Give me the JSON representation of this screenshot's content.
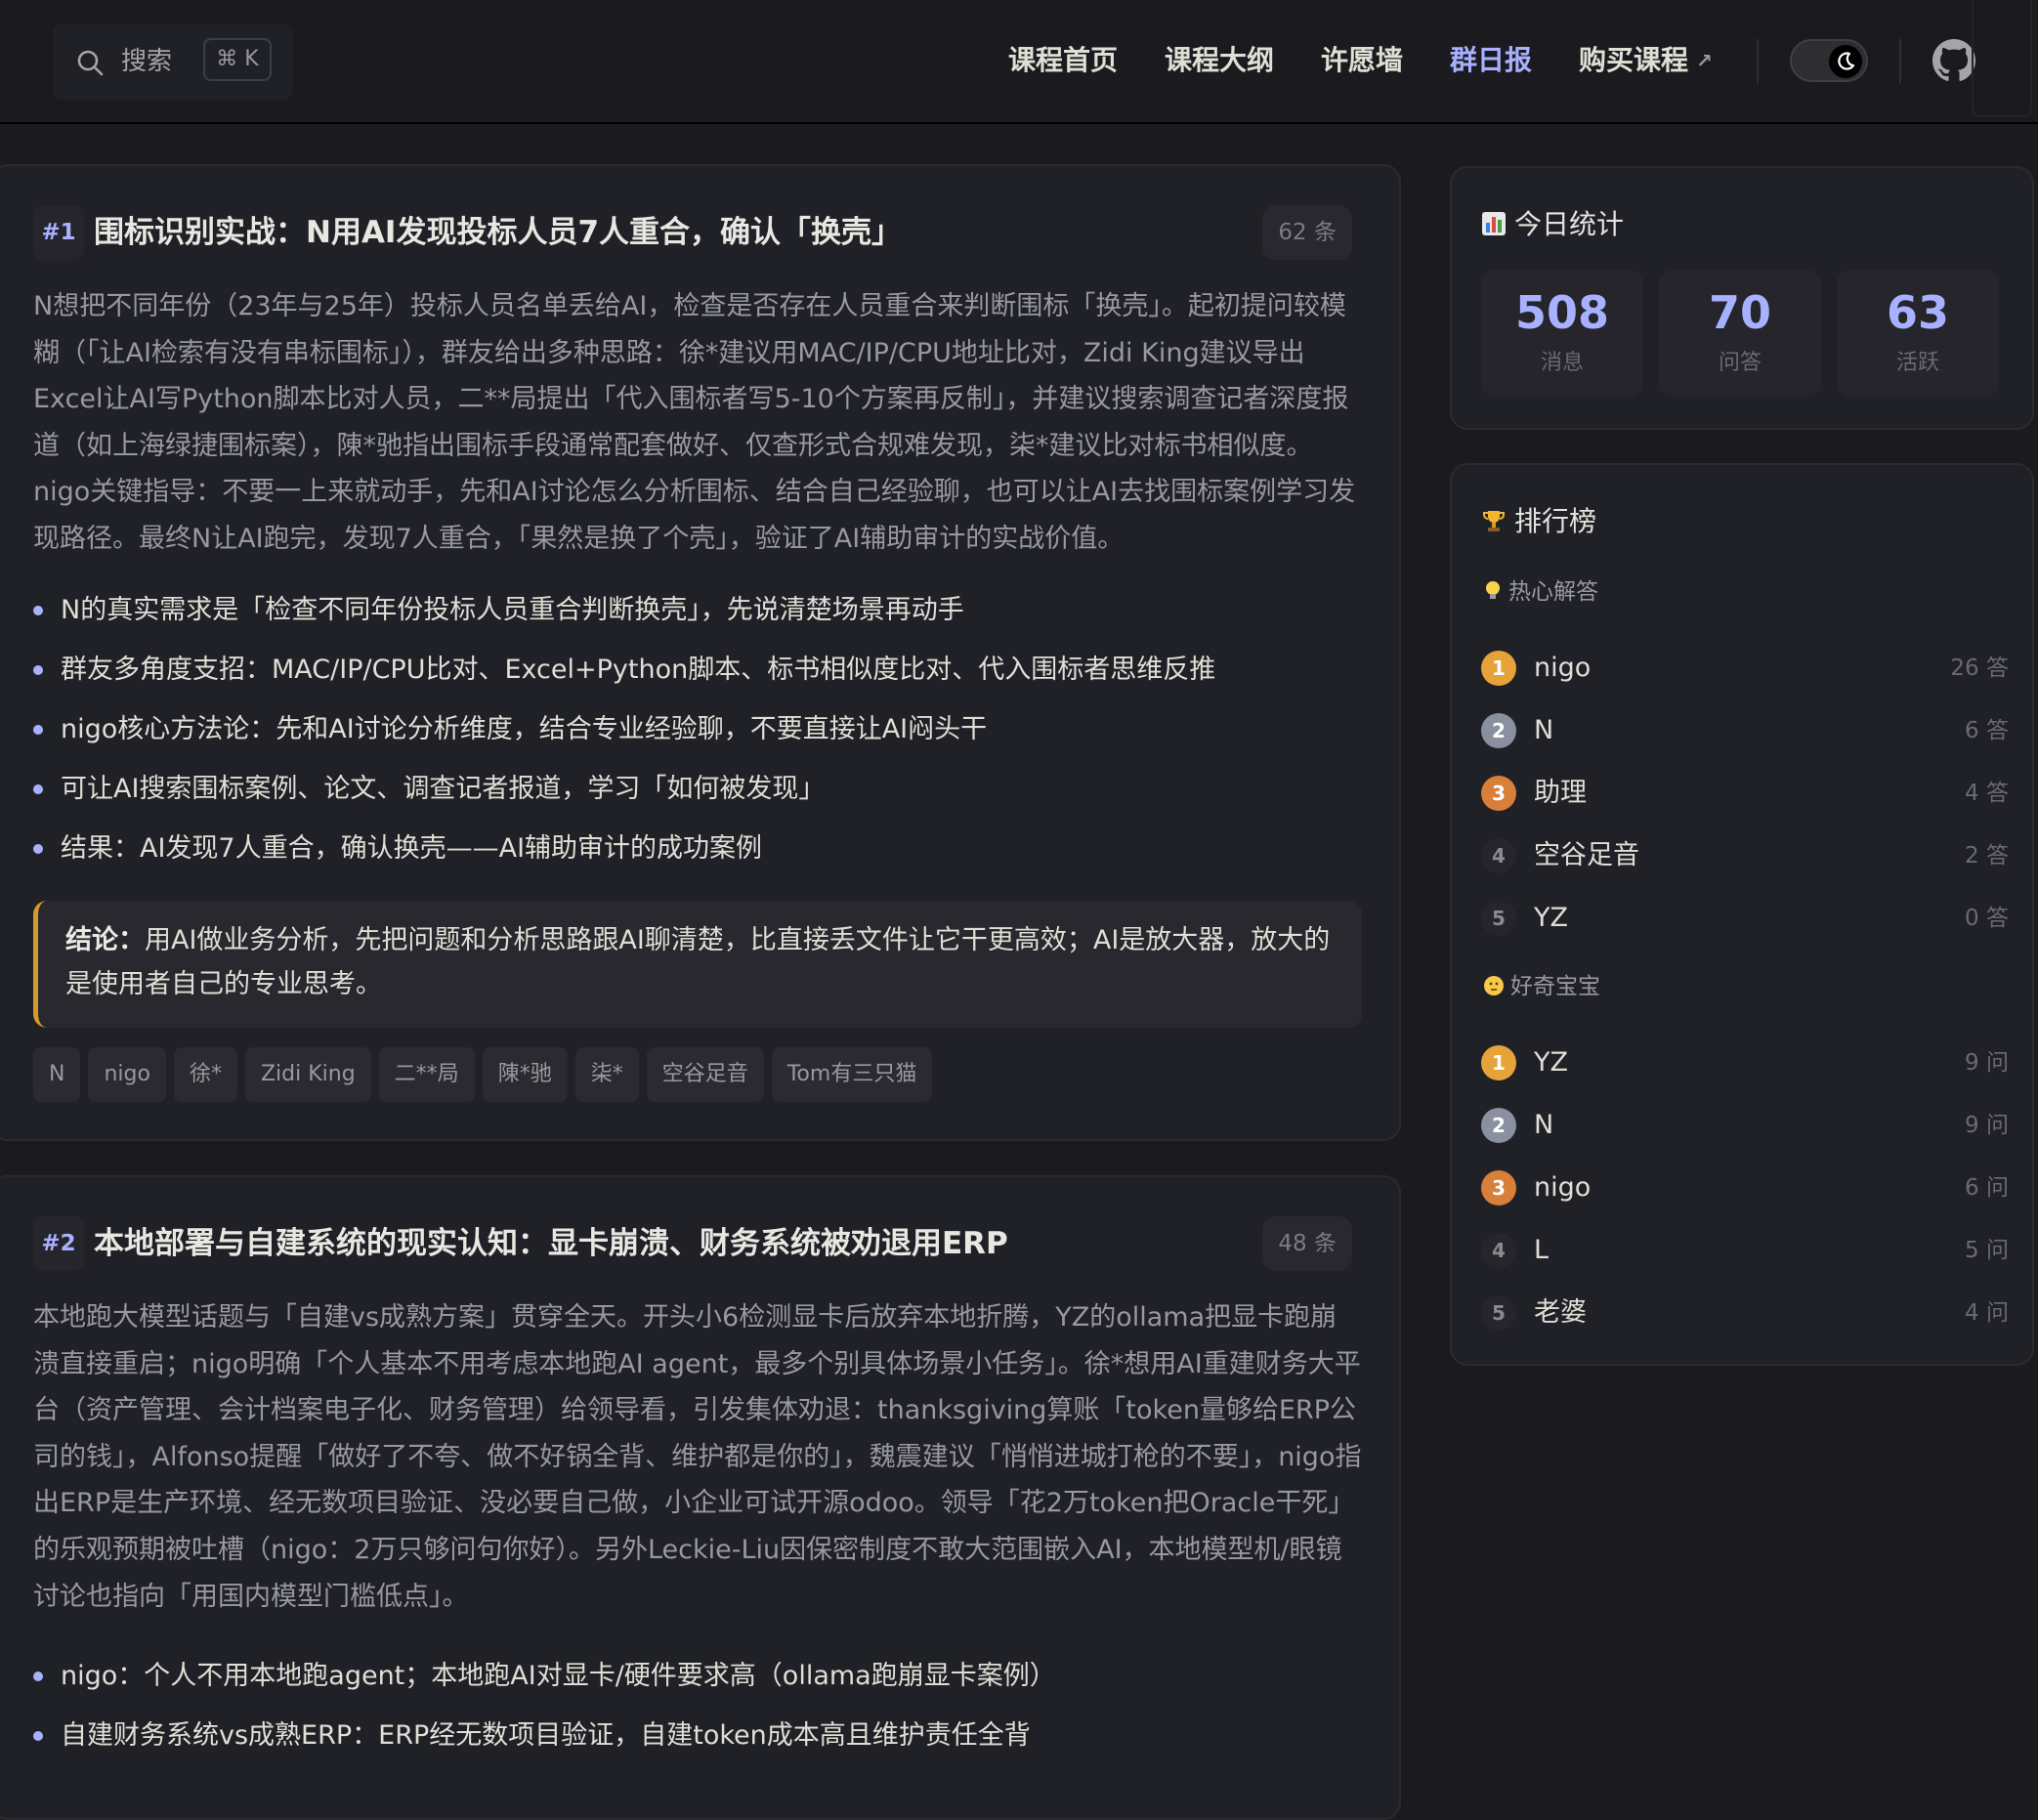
{
  "nav": {
    "search_label": "搜索",
    "search_shortcut": "⌘ K",
    "items": [
      {
        "label": "课程首页"
      },
      {
        "label": "课程大纲"
      },
      {
        "label": "许愿墙"
      },
      {
        "label": "群日报"
      },
      {
        "label": "购买课程"
      }
    ],
    "active_index": 3,
    "external_arrow": "↗"
  },
  "reports": [
    {
      "rank": "#1",
      "title": "围标识别实战：N用AI发现投标人员7人重合，确认「换壳」",
      "count": "62 条",
      "summary": "N想把不同年份（23年与25年）投标人员名单丢给AI，检查是否存在人员重合来判断围标「换壳」。起初提问较模糊（「让AI检索有没有串标围标」），群友给出多种思路：徐*建议用MAC/IP/CPU地址比对，Zidi King建议导出Excel让AI写Python脚本比对人员，二**局提出「代入围标者写5-10个方案再反制」，并建议搜索调查记者深度报道（如上海绿捷围标案），陳*驰指出围标手段通常配套做好、仅查形式合规难发现，柒*建议比对标书相似度。nigo关键指导：不要一上来就动手，先和AI讨论怎么分析围标、结合自己经验聊，也可以让AI去找围标案例学习发现路径。最终N让AI跑完，发现7人重合，「果然是换了个壳」，验证了AI辅助审计的实战价值。",
      "bullets": [
        "N的真实需求是「检查不同年份投标人员重合判断换壳」，先说清楚场景再动手",
        "群友多角度支招：MAC/IP/CPU比对、Excel+Python脚本、标书相似度比对、代入围标者思维反推",
        "nigo核心方法论：先和AI讨论分析维度，结合专业经验聊，不要直接让AI闷头干",
        "可让AI搜索围标案例、论文、调查记者报道，学习「如何被发现」",
        "结果：AI发现7人重合，确认换壳——AI辅助审计的成功案例"
      ],
      "conclusion_label": "结论：",
      "conclusion_text": "用AI做业务分析，先把问题和分析思路跟AI聊清楚，比直接丢文件让它干更高效；AI是放大器，放大的是使用者自己的专业思考。",
      "tags": [
        "N",
        "nigo",
        "徐*",
        "Zidi King",
        "二**局",
        "陳*驰",
        "柒*",
        "空谷足音",
        "Tom有三只猫"
      ]
    },
    {
      "rank": "#2",
      "title": "本地部署与自建系统的现实认知：显卡崩溃、财务系统被劝退用ERP",
      "count": "48 条",
      "summary": "本地跑大模型话题与「自建vs成熟方案」贯穿全天。开头小6检测显卡后放弃本地折腾，YZ的ollama把显卡跑崩溃直接重启；nigo明确「个人基本不用考虑本地跑AI agent，最多个别具体场景小任务」。徐*想用AI重建财务大平台（资产管理、会计档案电子化、财务管理）给领导看，引发集体劝退：thanksgiving算账「token量够给ERP公司的钱」，Alfonso提醒「做好了不夸、做不好锅全背、维护都是你的」，魏震建议「悄悄进城打枪的不要」，nigo指出ERP是生产环境、经无数项目验证、没必要自己做，小企业可试开源odoo。领导「花2万token把Oracle干死」的乐观预期被吐槽（nigo：2万只够问句你好）。另外Leckie-Liu因保密制度不敢大范围嵌入AI，本地模型机/眼镜讨论也指向「用国内模型门槛低点」。",
      "bullets": [
        "nigo：个人不用本地跑agent；本地跑AI对显卡/硬件要求高（ollama跑崩显卡案例）",
        "自建财务系统vs成熟ERP：ERP经无数项目验证，自建token成本高且维护责任全背"
      ]
    }
  ],
  "stats": {
    "title": "今日统计",
    "icon": "bar-chart-icon",
    "items": [
      {
        "value": "508",
        "label": "消息"
      },
      {
        "value": "70",
        "label": "问答"
      },
      {
        "value": "63",
        "label": "活跃"
      }
    ]
  },
  "leaderboard": {
    "title": "排行榜",
    "icon": "trophy-icon",
    "groups": [
      {
        "title": "热心解答",
        "icon": "lightbulb-icon",
        "rows": [
          {
            "rank": "1",
            "name": "nigo",
            "count": "26 答"
          },
          {
            "rank": "2",
            "name": "N",
            "count": "6 答"
          },
          {
            "rank": "3",
            "name": "助理",
            "count": "4 答"
          },
          {
            "rank": "4",
            "name": "空谷足音",
            "count": "2 答"
          },
          {
            "rank": "5",
            "name": "YZ",
            "count": "0 答"
          }
        ]
      },
      {
        "title": "好奇宝宝",
        "icon": "thinking-face-icon",
        "rows": [
          {
            "rank": "1",
            "name": "YZ",
            "count": "9 问"
          },
          {
            "rank": "2",
            "name": "N",
            "count": "9 问"
          },
          {
            "rank": "3",
            "name": "nigo",
            "count": "6 问"
          },
          {
            "rank": "4",
            "name": "L",
            "count": "5 问"
          },
          {
            "rank": "5",
            "name": "老婆",
            "count": "4 问"
          }
        ]
      }
    ]
  },
  "colors": {
    "accent": "#a8b1ff",
    "conclusion_border": "#d59a2c",
    "background": "#1b1b1f",
    "card": "#202127"
  }
}
